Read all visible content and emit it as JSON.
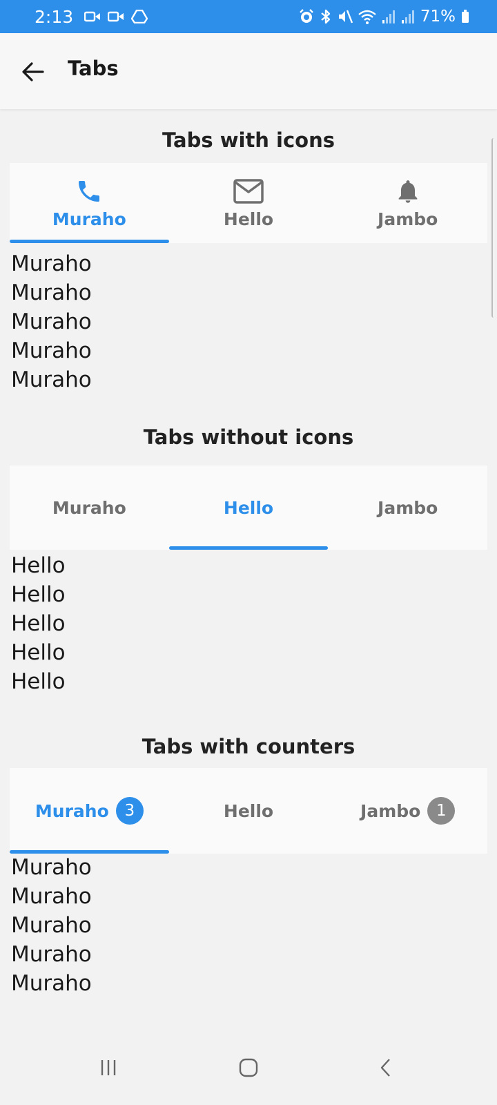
{
  "status_bar": {
    "time": "2:13",
    "battery": "71%",
    "icons_left": [
      "video-icon",
      "video-icon",
      "drive-icon"
    ],
    "icons_right": [
      "alarm-icon",
      "bluetooth-icon",
      "mute-icon",
      "wifi-icon",
      "signal-icon",
      "signal-icon",
      "battery-icon"
    ]
  },
  "app_bar": {
    "title": "Tabs",
    "back_icon": "arrow-back-icon"
  },
  "section_icons": {
    "title": "Tabs with icons",
    "tabs": [
      {
        "label": "Muraho",
        "icon": "phone-icon",
        "active": true
      },
      {
        "label": "Hello",
        "icon": "mail-icon",
        "active": false
      },
      {
        "label": "Jambo",
        "icon": "bell-icon",
        "active": false
      }
    ],
    "content": [
      "Muraho",
      "Muraho",
      "Muraho",
      "Muraho",
      "Muraho"
    ]
  },
  "section_plain": {
    "title": "Tabs without icons",
    "tabs": [
      {
        "label": "Muraho",
        "active": false
      },
      {
        "label": "Hello",
        "active": true
      },
      {
        "label": "Jambo",
        "active": false
      }
    ],
    "content": [
      "Hello",
      "Hello",
      "Hello",
      "Hello",
      "Hello"
    ]
  },
  "section_counters": {
    "title": "Tabs with counters",
    "tabs": [
      {
        "label": "Muraho",
        "count": "3",
        "active": true
      },
      {
        "label": "Hello",
        "count": null,
        "active": false
      },
      {
        "label": "Jambo",
        "count": "1",
        "active": false
      }
    ],
    "content": [
      "Muraho",
      "Muraho",
      "Muraho",
      "Muraho",
      "Muraho"
    ]
  },
  "colors": {
    "accent": "#2d8fea",
    "status_bar": "#2d8fea",
    "inactive_tab": "#6f6f6f",
    "badge_inactive": "#8a8a8a"
  }
}
